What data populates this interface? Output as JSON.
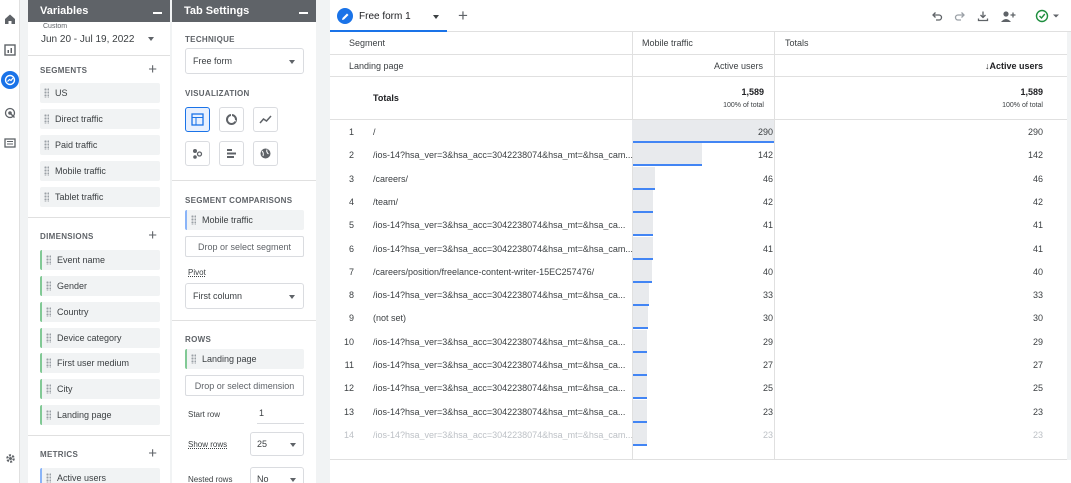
{
  "nav": {
    "icons": [
      "home-icon",
      "reports-icon",
      "explore-icon",
      "advertising-icon",
      "configure-icon",
      "settings-icon"
    ]
  },
  "variables": {
    "title": "Variables",
    "date_label": "Custom",
    "date_range": "Jun 20 - Jul 19, 2022",
    "segments_label": "SEGMENTS",
    "segments": [
      "US",
      "Direct traffic",
      "Paid traffic",
      "Mobile traffic",
      "Tablet traffic"
    ],
    "dimensions_label": "DIMENSIONS",
    "dimensions": [
      "Event name",
      "Gender",
      "Country",
      "Device category",
      "First user medium",
      "City",
      "Landing page"
    ],
    "metrics_label": "METRICS",
    "metrics": [
      "Active users"
    ]
  },
  "tab_settings": {
    "title": "Tab Settings",
    "technique_label": "TECHNIQUE",
    "technique_value": "Free form",
    "visualization_label": "VISUALIZATION",
    "segment_comparisons_label": "SEGMENT COMPARISONS",
    "segment_chip": "Mobile traffic",
    "segment_drop": "Drop or select segment",
    "pivot_label": "Pivot",
    "pivot_value": "First column",
    "rows_label": "ROWS",
    "rows_chip": "Landing page",
    "rows_drop": "Drop or select dimension",
    "start_row_label": "Start row",
    "start_row_value": "1",
    "show_rows_label": "Show rows",
    "show_rows_value": "25",
    "nested_rows_label": "Nested rows",
    "nested_rows_value": "No"
  },
  "canvas": {
    "tab_title": "Free form 1",
    "header": {
      "segment_label": "Segment",
      "mobile_traffic": "Mobile traffic",
      "totals_col": "Totals",
      "landing_page": "Landing page",
      "active_users_1": "Active users",
      "active_users_2": "↓Active users",
      "totals_row_label": "Totals",
      "total_val_1": "1,589",
      "total_pct_1": "100% of total",
      "total_val_2": "1,589",
      "total_pct_2": "100% of total"
    },
    "rows": [
      {
        "idx": "1",
        "page": "/",
        "v1": "290",
        "v2": "290",
        "frac": 1.0
      },
      {
        "idx": "2",
        "page": "/ios-14?hsa_ver=3&hsa_acc=3042238074&hsa_mt=&hsa_cam...",
        "v1": "142",
        "v2": "142",
        "frac": 0.49
      },
      {
        "idx": "3",
        "page": "/careers/",
        "v1": "46",
        "v2": "46",
        "frac": 0.159
      },
      {
        "idx": "4",
        "page": "/team/",
        "v1": "42",
        "v2": "42",
        "frac": 0.145
      },
      {
        "idx": "5",
        "page": "/ios-14?hsa_ver=3&hsa_acc=3042238074&hsa_mt=&hsa_ca...",
        "v1": "41",
        "v2": "41",
        "frac": 0.141
      },
      {
        "idx": "6",
        "page": "/ios-14?hsa_ver=3&hsa_acc=3042238074&hsa_mt=&hsa_cam...",
        "v1": "41",
        "v2": "41",
        "frac": 0.141
      },
      {
        "idx": "7",
        "page": "/careers/position/freelance-content-writer-15EC257476/",
        "v1": "40",
        "v2": "40",
        "frac": 0.138
      },
      {
        "idx": "8",
        "page": "/ios-14?hsa_ver=3&hsa_acc=3042238074&hsa_mt=&hsa_ca...",
        "v1": "33",
        "v2": "33",
        "frac": 0.114
      },
      {
        "idx": "9",
        "page": "(not set)",
        "v1": "30",
        "v2": "30",
        "frac": 0.103
      },
      {
        "idx": "10",
        "page": "/ios-14?hsa_ver=3&hsa_acc=3042238074&hsa_mt=&hsa_ca...",
        "v1": "29",
        "v2": "29",
        "frac": 0.1
      },
      {
        "idx": "11",
        "page": "/ios-14?hsa_ver=3&hsa_acc=3042238074&hsa_mt=&hsa_ca...",
        "v1": "27",
        "v2": "27",
        "frac": 0.093
      },
      {
        "idx": "12",
        "page": "/ios-14?hsa_ver=3&hsa_acc=3042238074&hsa_mt=&hsa_ca...",
        "v1": "25",
        "v2": "25",
        "frac": 0.086
      },
      {
        "idx": "13",
        "page": "/ios-14?hsa_ver=3&hsa_acc=3042238074&hsa_mt=&hsa_ca...",
        "v1": "23",
        "v2": "23",
        "frac": 0.079
      },
      {
        "idx": "14",
        "page": "/ios-14?hsa_ver=3&hsa_acc=3042238074&hsa_mt=&hsa_cam...",
        "v1": "23",
        "v2": "23",
        "frac": 0.079
      }
    ]
  },
  "colors": {
    "accent": "#1a73e8",
    "bar": "#4285f4",
    "panel_header": "#5f6368"
  }
}
